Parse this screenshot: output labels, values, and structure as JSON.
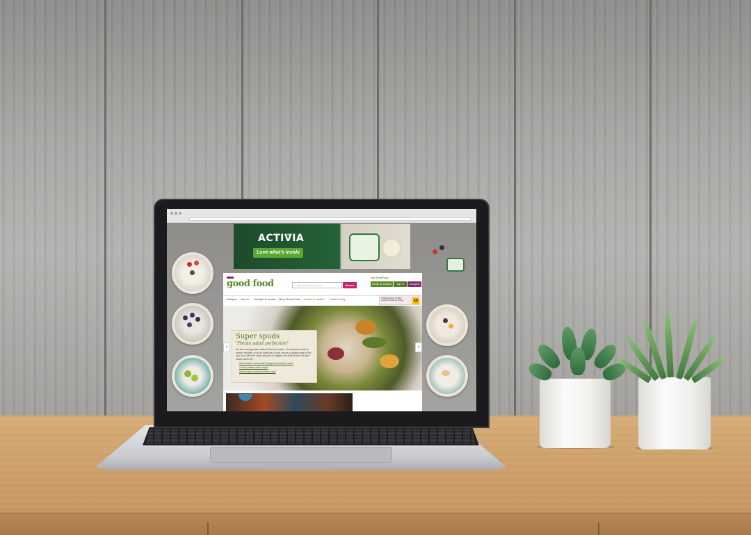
{
  "ad": {
    "brand": "ACTIVIA",
    "cta": "Love what's inside"
  },
  "site": {
    "logo": "good food",
    "search_placeholder": "Ingredients, dish, keyword...",
    "search_button": "Search",
    "my_good_food": "My Good Food",
    "create_account": "Create an account",
    "sign_in": "Sign in",
    "shopping_list": "Shopping List",
    "nav": [
      "Recipes",
      "How to",
      "Lifestyle & events",
      "More Good Food",
      "Health & nutrition",
      "Father's Day"
    ],
    "promo_text": "STREAM, BAKE, ON BBC GOOD FOOD BLUE, ISSUE",
    "promo_price": "£5",
    "hero": {
      "title": "Super spuds",
      "subtitle": "\"Potato salad perfection\"",
      "body": "We love serving potato salad at this time a year – it's the perfect side for warmer weather. It can be made into a main course by adding meat or fish, plus if you ditch the mayo and pack in veggies and herbs it ticks the right health boxes too.",
      "links": [
        "Roast radish, new potato & peppered mackerel salad",
        "Our top potato salad recipes",
        "Sweet soups to perfect potato salad"
      ]
    }
  },
  "colors": {
    "brand_green": "#5b8b2c",
    "search_pink": "#c4236b",
    "activia_green": "#246337"
  }
}
